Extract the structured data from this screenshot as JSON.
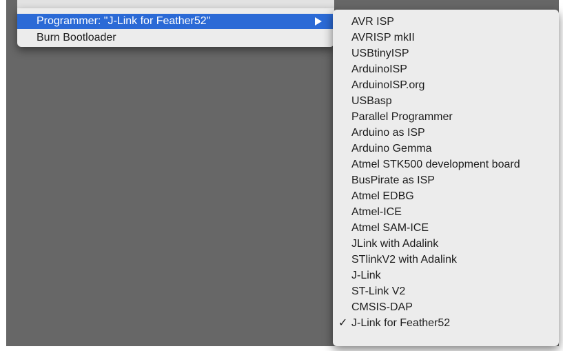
{
  "main_menu": {
    "items": [
      {
        "label": "Programmer: \"J-Link for Feather52\"",
        "highlighted": true,
        "has_submenu": true
      },
      {
        "label": "Burn Bootloader",
        "highlighted": false,
        "has_submenu": false
      }
    ]
  },
  "submenu": {
    "items": [
      {
        "label": "AVR ISP"
      },
      {
        "label": "AVRISP mkII"
      },
      {
        "label": "USBtinyISP"
      },
      {
        "label": "ArduinoISP"
      },
      {
        "label": "ArduinoISP.org"
      },
      {
        "label": "USBasp"
      },
      {
        "label": "Parallel Programmer"
      },
      {
        "label": "Arduino as ISP"
      },
      {
        "label": "Arduino Gemma"
      },
      {
        "label": "Atmel STK500 development board"
      },
      {
        "label": "BusPirate as ISP"
      },
      {
        "label": "Atmel EDBG"
      },
      {
        "label": "Atmel-ICE"
      },
      {
        "label": "Atmel SAM-ICE"
      },
      {
        "label": "JLink with Adalink"
      },
      {
        "label": "STlinkV2 with Adalink"
      },
      {
        "label": "J-Link"
      },
      {
        "label": "ST-Link V2"
      },
      {
        "label": "CMSIS-DAP"
      },
      {
        "label": "J-Link for Feather52",
        "checked": true,
        "check_mark": "✓"
      }
    ]
  },
  "colors": {
    "highlight": "#2b6ad6",
    "menu_background": "#ececec",
    "backdrop": "#676767"
  },
  "icons": {
    "submenu_arrow": "chevron-right-triangle",
    "checkmark": "checkmark"
  }
}
